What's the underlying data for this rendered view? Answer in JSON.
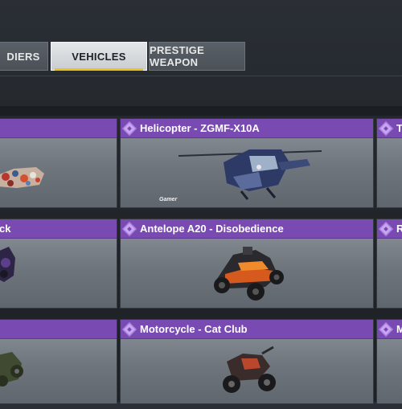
{
  "tabs": [
    {
      "label": "DIERS",
      "active": false
    },
    {
      "label": "VEHICLES",
      "active": true
    },
    {
      "label": "PRESTIGE WEAPON",
      "active": false
    }
  ],
  "colors": {
    "header_purple": "#7a4ab3",
    "active_tab_underline": "#e9c21c"
  },
  "cards": {
    "row1_left": {
      "title": ""
    },
    "row1_center": {
      "title": "Helicopter - ZGMF-X10A",
      "badge": "Gamer"
    },
    "row1_right": {
      "title": "T"
    },
    "row2_left": {
      "title": "ck"
    },
    "row2_center": {
      "title": "Antelope A20 - Disobedience"
    },
    "row2_right": {
      "title": "R"
    },
    "row3_left": {
      "title": ""
    },
    "row3_center": {
      "title": "Motorcycle - Cat Club"
    },
    "row3_right": {
      "title": "M"
    }
  }
}
